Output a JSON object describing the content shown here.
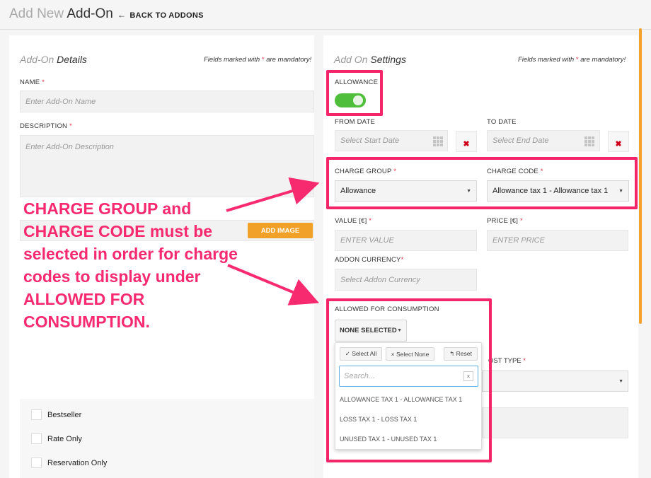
{
  "header": {
    "title_light": "Add New",
    "title_strong": "Add-On",
    "back_label": "BACK TO ADDONS",
    "back_icon": "left-arrow-icon"
  },
  "left": {
    "section_light": "Add-On",
    "section_strong": "Details",
    "mandatory_prefix": "Fields marked with",
    "mandatory_star": "*",
    "mandatory_suffix": "are mandatory!",
    "name_label": "NAME",
    "name_placeholder": "Enter Add-On Name",
    "description_label": "DESCRIPTION",
    "description_placeholder": "Enter Add-On Description",
    "add_image_label": "ADD IMAGE",
    "checkboxes": [
      "Bestseller",
      "Rate Only",
      "Reservation Only"
    ]
  },
  "right": {
    "section_light": "Add On",
    "section_strong": "Settings",
    "allowance_label": "ALLOWANCE",
    "allowance_on": true,
    "from_date_label": "FROM DATE",
    "from_date_placeholder": "Select Start Date",
    "to_date_label": "TO DATE",
    "to_date_placeholder": "Select End Date",
    "clear_icon": "✖",
    "charge_group_label": "CHARGE GROUP",
    "charge_group_value": "Allowance",
    "charge_code_label": "CHARGE CODE",
    "charge_code_value": "Allowance tax 1 - Allowance tax 1",
    "value_label": "VALUE [€]",
    "value_placeholder": "ENTER VALUE",
    "price_label": "PRICE [€]",
    "price_placeholder": "ENTER PRICE",
    "currency_label": "ADDON CURRENCY",
    "currency_placeholder": "Select Addon Currency",
    "allowed_label": "ALLOWED FOR CONSUMPTION",
    "none_selected": "NONE SELECTED",
    "cost_type_label_partial": "OST TYPE",
    "star": "*"
  },
  "dropdown": {
    "select_all": "✓ Select All",
    "select_none": "× Select None",
    "reset": "↰ Reset",
    "search_placeholder": "Search...",
    "search_clear": "×",
    "options": [
      "ALLOWANCE TAX 1 - ALLOWANCE TAX 1",
      "LOSS TAX 1 - LOSS TAX 1",
      "UNUSED TAX 1 - UNUSED TAX 1"
    ]
  },
  "annotation": {
    "text": "CHARGE GROUP and CHARGE CODE must be selected in order for charge codes to display under ALLOWED FOR CONSUMPTION.",
    "color": "#f72a70"
  },
  "colors": {
    "highlight": "#f3266a",
    "toggle_on": "#4fbe3a",
    "accent_orange": "#f1a127",
    "required_star": "#e8334a"
  }
}
